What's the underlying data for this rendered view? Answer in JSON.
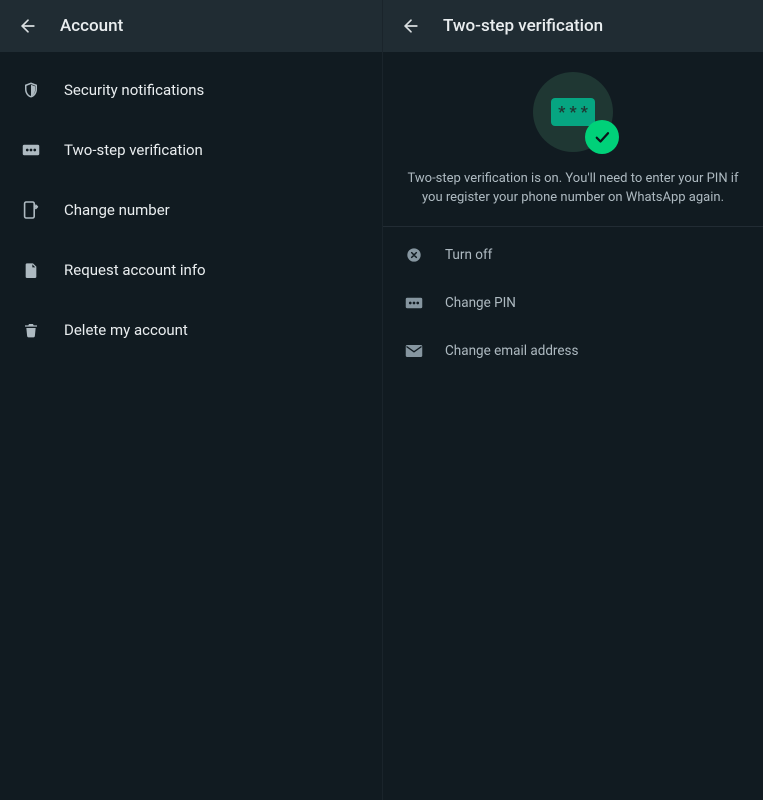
{
  "left": {
    "title": "Account",
    "items": [
      {
        "label": "Security notifications"
      },
      {
        "label": "Two-step verification"
      },
      {
        "label": "Change number"
      },
      {
        "label": "Request account info"
      },
      {
        "label": "Delete my account"
      }
    ]
  },
  "right": {
    "title": "Two-step verification",
    "description": "Two-step verification is on. You'll need to enter your PIN if you register your phone number on WhatsApp again.",
    "actions": [
      {
        "label": "Turn off"
      },
      {
        "label": "Change PIN"
      },
      {
        "label": "Change email address"
      }
    ]
  },
  "colors": {
    "accent": "#00d179",
    "pinCard": "#06a581",
    "heroCircle": "#1f3733"
  }
}
